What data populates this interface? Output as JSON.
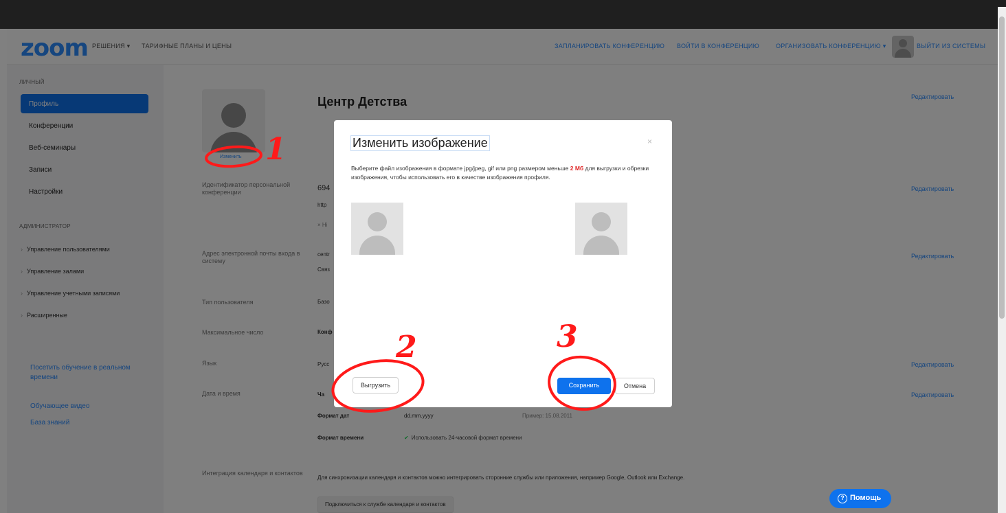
{
  "header": {
    "logo": "zoom",
    "nav_solutions": "РЕШЕНИЯ ▾",
    "nav_plans": "ТАРИФНЫЕ ПЛАНЫ И ЦЕНЫ",
    "nav_schedule": "ЗАПЛАНИРОВАТЬ КОНФЕРЕНЦИЮ",
    "nav_join": "ВОЙТИ В КОНФЕРЕНЦИЮ",
    "nav_host": "ОРГАНИЗОВАТЬ КОНФЕРЕНЦИЮ ▾",
    "nav_signout": "ВЫЙТИ ИЗ СИСТЕМЫ"
  },
  "sidebar": {
    "personal_label": "ЛИЧНЫЙ",
    "items": [
      {
        "label": "Профиль"
      },
      {
        "label": "Конференции"
      },
      {
        "label": "Веб-семинары"
      },
      {
        "label": "Записи"
      },
      {
        "label": "Настройки"
      }
    ],
    "admin_label": "АДМИНИСТРАТОР",
    "admin_items": [
      {
        "label": "Управление пользователями"
      },
      {
        "label": "Управление залами"
      },
      {
        "label": "Управление учетными записями"
      },
      {
        "label": "Расширенные"
      }
    ],
    "links": [
      {
        "label": "Посетить обучение в реальном времени"
      },
      {
        "label": "Обучающее видео"
      },
      {
        "label": "База знаний"
      }
    ]
  },
  "profile": {
    "change_link": "Изменить",
    "name": "Центр Детства",
    "edit_label": "Редактировать",
    "rows": {
      "pmi_label": "Идентификатор персональной конференции",
      "pmi_value": "694",
      "pmi_url": "http",
      "pmi_extra": "× Hi",
      "email_label": "Адрес электронной почты входа в систему",
      "email_value": "centr",
      "email_link": "Связ",
      "usertype_label": "Тип пользователя",
      "usertype_value": "Базо",
      "capacity_label": "Максимальное число",
      "capacity_value": "Конф",
      "language_label": "Язык",
      "language_value": "Русс",
      "datetime_label": "Дата и время",
      "timezone_value": "Ча",
      "date_format_label": "Формат дат",
      "date_format_value": "dd.mm.yyyy",
      "date_example": "Пример: 15.08.2011",
      "time_format_label": "Формат времени",
      "time_format_value": "Использовать 24-часовой формат времени",
      "calendar_label": "Интеграция календаря и контактов",
      "calendar_desc": "Для синхронизации календаря и контактов можно интегрировать сторонние службы или приложения, например Google, Outlook или Exchange.",
      "calendar_button": "Подключиться к службе календаря и контактов"
    }
  },
  "help_button": "Помощь",
  "modal": {
    "title": "Изменить изображение",
    "close": "×",
    "desc_before": "Выберите файл изображения в формате jpg/jpeg, gif или png размером меньше ",
    "desc_size": "2 Мб",
    "desc_after": " для выгрузки и обрезки изображения, чтобы использовать его в качестве изображения профиля.",
    "upload_button": "Выгрузить",
    "save_button": "Сохранить",
    "cancel_button": "Отмена"
  },
  "annotations": [
    "1",
    "2",
    "3"
  ],
  "colors": {
    "accent": "#0e72ed",
    "brand": "#2d8cff",
    "annotation": "#ff1a1a"
  }
}
